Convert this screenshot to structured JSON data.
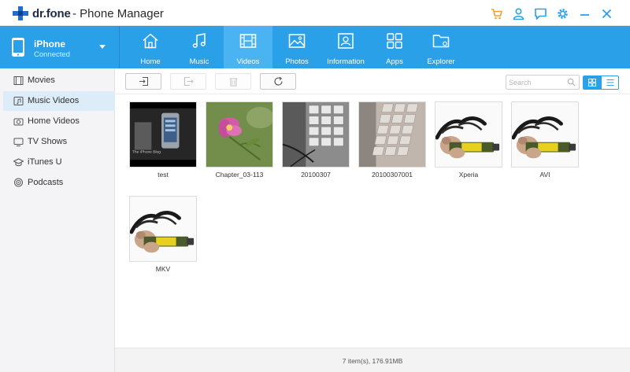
{
  "app": {
    "brand": "dr.fone",
    "title": "- Phone Manager"
  },
  "titlebar_buttons": [
    {
      "name": "cart-icon",
      "color": "#f0a030"
    },
    {
      "name": "user-icon",
      "color": "#2aa0e8"
    },
    {
      "name": "feedback-icon",
      "color": "#2aa0e8"
    },
    {
      "name": "gear-icon",
      "color": "#2aa0e8"
    },
    {
      "name": "minimize-icon",
      "color": "#2aa0e8"
    },
    {
      "name": "close-icon",
      "color": "#2aa0e8"
    }
  ],
  "device": {
    "name": "iPhone",
    "status": "Connected"
  },
  "nav": {
    "tabs": [
      {
        "label": "Home",
        "icon": "home-icon"
      },
      {
        "label": "Music",
        "icon": "music-icon"
      },
      {
        "label": "Videos",
        "icon": "film-icon",
        "active": true
      },
      {
        "label": "Photos",
        "icon": "photo-icon"
      },
      {
        "label": "Information",
        "icon": "contact-card-icon"
      },
      {
        "label": "Apps",
        "icon": "apps-icon"
      },
      {
        "label": "Explorer",
        "icon": "folder-icon"
      }
    ]
  },
  "sidebar": {
    "items": [
      {
        "label": "Movies",
        "icon": "film-strip-icon"
      },
      {
        "label": "Music Videos",
        "icon": "music-video-icon",
        "active": true
      },
      {
        "label": "Home Videos",
        "icon": "camera-icon"
      },
      {
        "label": "TV Shows",
        "icon": "tv-icon"
      },
      {
        "label": "iTunes U",
        "icon": "graduation-cap-icon"
      },
      {
        "label": "Podcasts",
        "icon": "podcast-icon"
      }
    ]
  },
  "toolbar": {
    "buttons": [
      {
        "name": "import-button",
        "icon": "import-icon",
        "enabled": true
      },
      {
        "name": "export-button",
        "icon": "export-icon",
        "enabled": false
      },
      {
        "name": "delete-button",
        "icon": "trash-icon",
        "enabled": false
      },
      {
        "name": "refresh-button",
        "icon": "refresh-icon",
        "enabled": true
      }
    ],
    "search_placeholder": "Search",
    "view_mode": "grid"
  },
  "videos": [
    {
      "label": "test",
      "thumb": "phone-screen"
    },
    {
      "label": "Chapter_03-113",
      "thumb": "pink-flower"
    },
    {
      "label": "20100307",
      "thumb": "keyboard"
    },
    {
      "label": "20100307001",
      "thumb": "keyboard-blur"
    },
    {
      "label": "Xperia",
      "thumb": "hand-sketch"
    },
    {
      "label": "AVI",
      "thumb": "hand-sketch"
    },
    {
      "label": "MKV",
      "thumb": "hand-sketch"
    }
  ],
  "status": {
    "summary": "7 item(s), 176.91MB"
  },
  "colors": {
    "accent": "#2aa0e8",
    "active_tab": "#4ab4f3",
    "sidebar_active": "#dcecf8",
    "cart": "#f0a030"
  }
}
